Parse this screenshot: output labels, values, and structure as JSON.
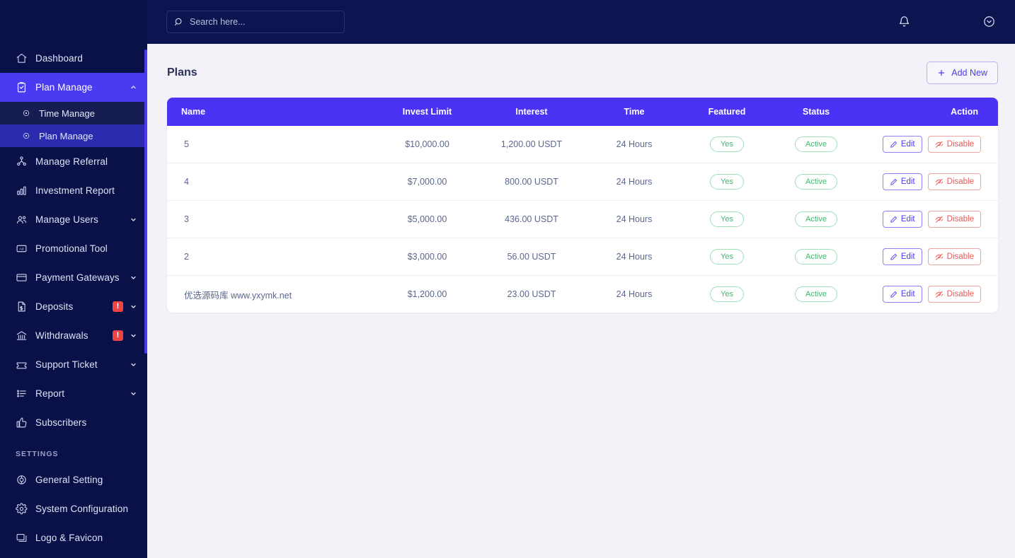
{
  "brand": {
    "logo_text": ""
  },
  "topbar": {
    "search_placeholder": "Search here...",
    "search_value": "",
    "search_icon": "search-icon",
    "bell_icon": "bell-icon",
    "profile_icon": "chevron-down-circle-icon"
  },
  "sidebar": {
    "items": [
      {
        "label": "Dashboard",
        "icon": "home-icon",
        "active": false,
        "chevron": "",
        "badge": ""
      },
      {
        "label": "Plan Manage",
        "icon": "clipboard-check-icon",
        "active": true,
        "chevron": "up",
        "badge": ""
      },
      {
        "label": "Manage Referral",
        "icon": "referral-tree-icon",
        "active": false,
        "chevron": "",
        "badge": ""
      },
      {
        "label": "Investment Report",
        "icon": "bar-chart-icon",
        "active": false,
        "chevron": "",
        "badge": ""
      },
      {
        "label": "Manage Users",
        "icon": "users-icon",
        "active": false,
        "chevron": "down",
        "badge": ""
      },
      {
        "label": "Promotional Tool",
        "icon": "ad-banner-icon",
        "active": false,
        "chevron": "",
        "badge": ""
      },
      {
        "label": "Payment Gateways",
        "icon": "credit-card-icon",
        "active": false,
        "chevron": "down",
        "badge": ""
      },
      {
        "label": "Deposits",
        "icon": "document-dollar-icon",
        "active": false,
        "chevron": "down",
        "badge": "!"
      },
      {
        "label": "Withdrawals",
        "icon": "bank-icon",
        "active": false,
        "chevron": "down",
        "badge": "!"
      },
      {
        "label": "Support Ticket",
        "icon": "ticket-icon",
        "active": false,
        "chevron": "down",
        "badge": ""
      },
      {
        "label": "Report",
        "icon": "list-report-icon",
        "active": false,
        "chevron": "down",
        "badge": ""
      },
      {
        "label": "Subscribers",
        "icon": "thumbs-up-icon",
        "active": false,
        "chevron": "",
        "badge": ""
      }
    ],
    "submenu": [
      {
        "label": "Time Manage",
        "icon": "circle-dot-icon",
        "active": false
      },
      {
        "label": "Plan Manage",
        "icon": "circle-dot-icon",
        "active": true
      }
    ],
    "settings_heading": "SETTINGS",
    "settings_items": [
      {
        "label": "General Setting",
        "icon": "gear-outline-icon"
      },
      {
        "label": "System Configuration",
        "icon": "cog-icon"
      },
      {
        "label": "Logo & Favicon",
        "icon": "image-window-icon"
      }
    ]
  },
  "main": {
    "page_title": "Plans",
    "add_new_label": "Add New",
    "add_new_icon": "plus-icon",
    "table": {
      "columns": [
        "Name",
        "Invest Limit",
        "Interest",
        "Time",
        "Featured",
        "Status",
        "Action"
      ],
      "rows": [
        {
          "name": "5",
          "invest_limit": "$10,000.00",
          "interest": "1,200.00 USDT",
          "time": "24 Hours",
          "featured": "Yes",
          "status": "Active",
          "edit": "Edit",
          "disable": "Disable"
        },
        {
          "name": "4",
          "invest_limit": "$7,000.00",
          "interest": "800.00 USDT",
          "time": "24 Hours",
          "featured": "Yes",
          "status": "Active",
          "edit": "Edit",
          "disable": "Disable"
        },
        {
          "name": "3",
          "invest_limit": "$5,000.00",
          "interest": "436.00 USDT",
          "time": "24 Hours",
          "featured": "Yes",
          "status": "Active",
          "edit": "Edit",
          "disable": "Disable"
        },
        {
          "name": "2",
          "invest_limit": "$3,000.00",
          "interest": "56.00 USDT",
          "time": "24 Hours",
          "featured": "Yes",
          "status": "Active",
          "edit": "Edit",
          "disable": "Disable"
        },
        {
          "name": "优选源码库 www.yxymk.net",
          "invest_limit": "$1,200.00",
          "interest": "23.00 USDT",
          "time": "24 Hours",
          "featured": "Yes",
          "status": "Active",
          "edit": "Edit",
          "disable": "Disable"
        }
      ]
    }
  },
  "colors": {
    "sidebar_bg": "#0a1048",
    "topbar_bg": "#0d1550",
    "accent": "#4a3bf0",
    "table_header": "#4a33f5",
    "page_bg": "#f2f2f8",
    "success": "#3aba6d",
    "danger": "#ef5656"
  }
}
